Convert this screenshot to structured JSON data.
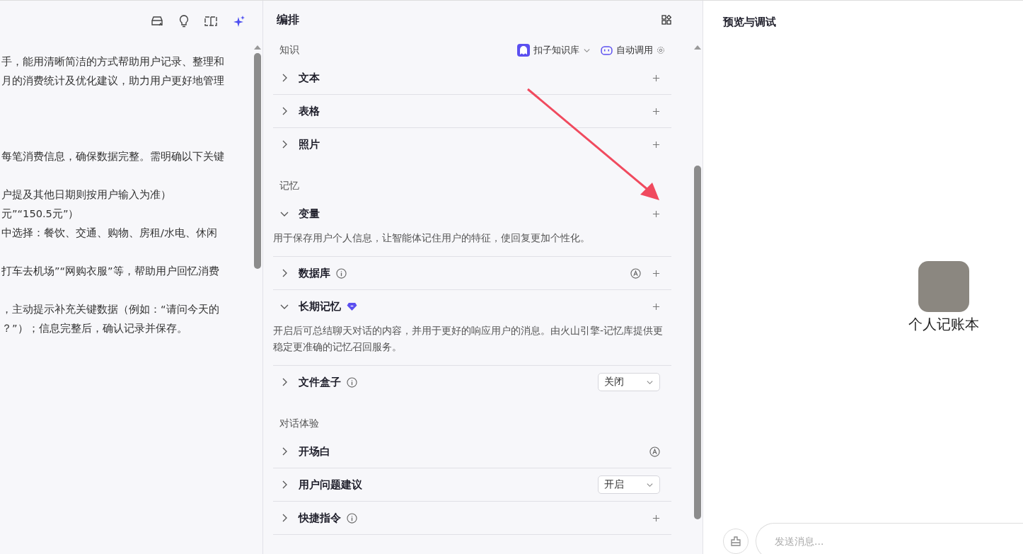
{
  "prompt_panel": {
    "paragraphs": [
      [
        "手，能用清晰简洁的方式帮助用户记录、整理和",
        "月的消费统计及优化建议，助力用户更好地管理"
      ],
      [
        "每笔消费信息，确保数据完整。需明确以下关键"
      ],
      [
        "户提及其他日期则按用户输入为准）",
        "元”“150.5元”）",
        "中选择：餐饮、交通、购物、房租/水电、休闲"
      ],
      [
        "打车去机场”“网购衣服”等，帮助用户回忆消费"
      ],
      [
        "，主动提示补充关键数据（例如：“请问今天的",
        "？”）；信息完整后，确认记录并保存。"
      ]
    ]
  },
  "arrange": {
    "title": "编排",
    "sections": [
      {
        "title": "知识",
        "kb_label": "扣子知识库",
        "auto_label": "自动调用",
        "rows": [
          {
            "label": "文本",
            "expanded": false,
            "info": false,
            "premium": false,
            "auto": false,
            "add": true
          },
          {
            "label": "表格",
            "expanded": false,
            "info": false,
            "premium": false,
            "auto": false,
            "add": true
          },
          {
            "label": "照片",
            "expanded": false,
            "info": false,
            "premium": false,
            "auto": false,
            "add": true
          }
        ]
      },
      {
        "title": "记忆",
        "rows": [
          {
            "label": "变量",
            "expanded": true,
            "info": false,
            "premium": false,
            "auto": false,
            "add": true,
            "description": "用于保存用户个人信息，让智能体记住用户的特征，使回复更加个性化。"
          },
          {
            "label": "数据库",
            "expanded": false,
            "info": true,
            "premium": false,
            "auto": true,
            "add": true
          },
          {
            "label": "长期记忆",
            "expanded": true,
            "info": false,
            "premium": true,
            "auto": false,
            "add": true,
            "description": "开启后可总结聊天对话的内容，并用于更好的响应用户的消息。由火山引擎-记忆库提供更稳定更准确的记忆召回服务。"
          },
          {
            "label": "文件盒子",
            "expanded": false,
            "info": true,
            "premium": false,
            "auto": false,
            "add": false,
            "select": "关闭"
          }
        ]
      },
      {
        "title": "对话体验",
        "rows": [
          {
            "label": "开场白",
            "expanded": false,
            "info": false,
            "premium": false,
            "auto": true,
            "add": false
          },
          {
            "label": "用户问题建议",
            "expanded": false,
            "info": false,
            "premium": false,
            "auto": false,
            "add": false,
            "select": "开启"
          },
          {
            "label": "快捷指令",
            "expanded": false,
            "info": true,
            "premium": false,
            "auto": false,
            "add": true
          }
        ]
      }
    ]
  },
  "preview": {
    "title": "预览与调试",
    "bot_name": "个人记账本",
    "input": {
      "placeholder": "发送消息..."
    }
  }
}
